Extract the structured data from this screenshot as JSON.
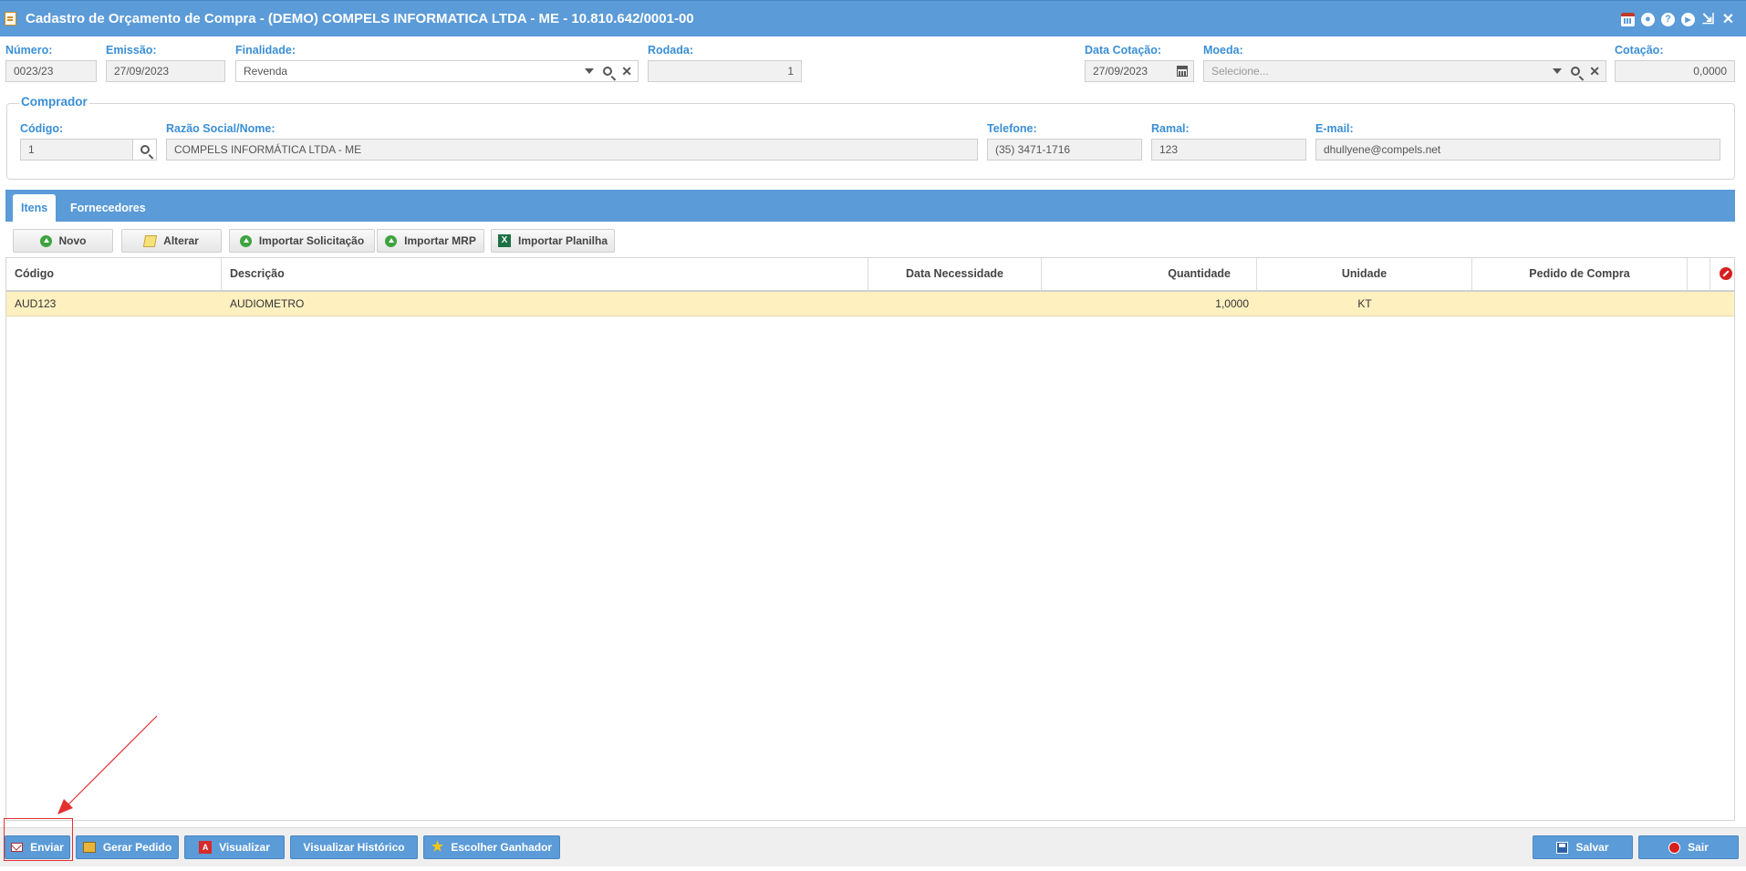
{
  "window": {
    "title": "Cadastro de Orçamento de Compra - (DEMO) COMPELS INFORMATICA LTDA - ME - 10.810.642/0001-00",
    "help_glyph": "?",
    "play_glyph": "▶",
    "minimize_glyph": "⇲",
    "close_glyph": "✕"
  },
  "header": {
    "numero": {
      "label": "Número:",
      "value": "0023/23"
    },
    "emissao": {
      "label": "Emissão:",
      "value": "27/09/2023"
    },
    "finalidade": {
      "label": "Finalidade:",
      "value": "Revenda"
    },
    "rodada": {
      "label": "Rodada:",
      "value": "1"
    },
    "data_cotacao": {
      "label": "Data Cotação:",
      "value": "27/09/2023"
    },
    "moeda": {
      "label": "Moeda:",
      "placeholder": "Selecione..."
    },
    "cotacao": {
      "label": "Cotação:",
      "value": "0,0000"
    }
  },
  "comprador": {
    "legend": "Comprador",
    "codigo": {
      "label": "Código:",
      "value": "1"
    },
    "razao_social": {
      "label": "Razão Social/Nome:",
      "value": "COMPELS INFORMÁTICA LTDA - ME"
    },
    "telefone": {
      "label": "Telefone:",
      "value": "(35) 3471-1716"
    },
    "ramal": {
      "label": "Ramal:",
      "value": "123"
    },
    "email": {
      "label": "E-mail:",
      "value": "dhullyene@compels.net"
    }
  },
  "tabs": [
    {
      "label": "Itens",
      "active": true
    },
    {
      "label": "Fornecedores",
      "active": false
    }
  ],
  "toolbar": {
    "novo": "Novo",
    "alterar": "Alterar",
    "importar_solicitacao": "Importar Solicitação",
    "importar_mrp": "Importar MRP",
    "importar_planilha": "Importar Planilha",
    "excel_glyph": "X"
  },
  "grid": {
    "columns": [
      "Código",
      "Descrição",
      "Data Necessidade",
      "Quantidade",
      "Unidade",
      "Pedido de Compra"
    ],
    "rows": [
      {
        "codigo": "AUD123",
        "descricao": "AUDIOMETRO",
        "data_necessidade": "",
        "quantidade": "1,0000",
        "unidade": "KT",
        "pedido_compra": ""
      }
    ]
  },
  "footer": {
    "enviar": "Enviar",
    "gerar_pedido": "Gerar Pedido",
    "visualizar": "Visualizar",
    "visualizar_historico": "Visualizar Histórico",
    "escolher_ganhador": "Escolher Ganhador",
    "salvar": "Salvar",
    "sair": "Sair",
    "pdf_glyph": "A",
    "star_glyph": "★"
  },
  "colors": {
    "accent": "#5b9bd8",
    "label": "#3a8fd6",
    "row_selected": "#fff0c0",
    "annotation": "#e53030"
  }
}
